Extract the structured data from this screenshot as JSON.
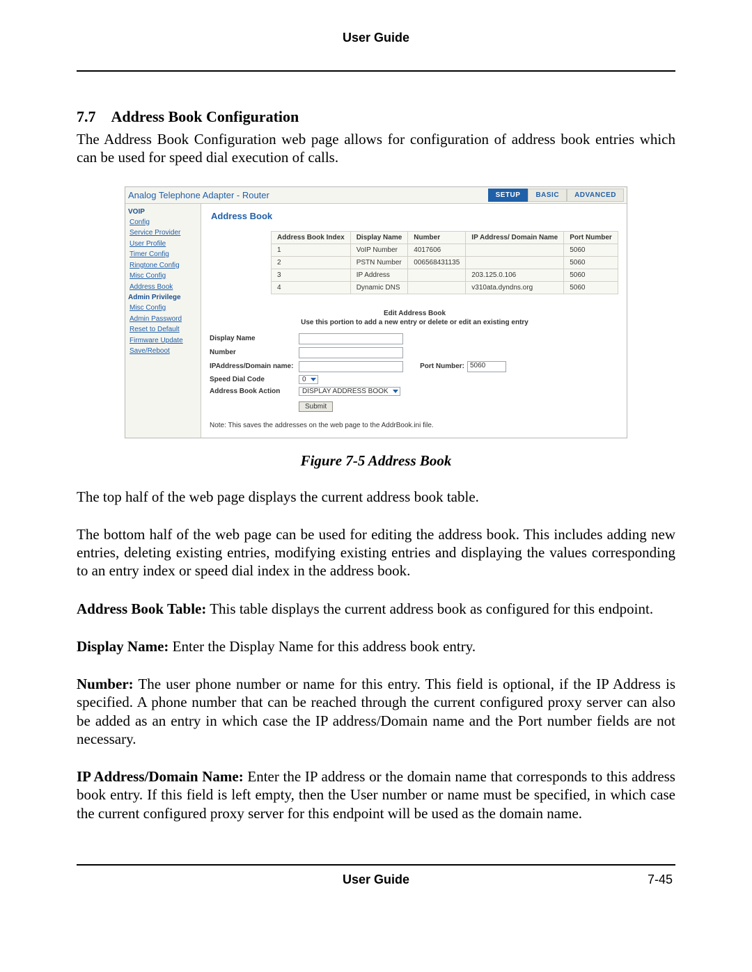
{
  "header": {
    "title": "User Guide"
  },
  "section": {
    "number": "7.7",
    "title": "Address Book Configuration",
    "intro": "The Address Book Configuration web page allows for configuration of address book entries which can be used for speed dial execution of calls."
  },
  "figure": {
    "app_title": "Analog Telephone Adapter - Router",
    "tabs": {
      "setup": "SETUP",
      "basic": "BASIC",
      "advanced": "ADVANCED"
    },
    "sidebar": {
      "group1": "VOIP",
      "items1": [
        "Config",
        "Service Provider",
        "User Profile",
        "Timer Config",
        "Ringtone Config",
        "Misc Config",
        "Address Book"
      ],
      "group2": "Admin Privilege",
      "items2": [
        "Misc Config",
        "Admin Password",
        "Reset to Default",
        "Firmware Update",
        "Save/Reboot"
      ]
    },
    "main": {
      "title": "Address Book",
      "columns": [
        "Address Book Index",
        "Display Name",
        "Number",
        "IP Address/ Domain Name",
        "Port Number"
      ],
      "rows": [
        {
          "index": "1",
          "display": "VoIP Number",
          "number": "4017606",
          "ip": "",
          "port": "5060"
        },
        {
          "index": "2",
          "display": "PSTN Number",
          "number": "006568431135",
          "ip": "",
          "port": "5060"
        },
        {
          "index": "3",
          "display": "IP Address",
          "number": "",
          "ip": "203.125.0.106",
          "port": "5060"
        },
        {
          "index": "4",
          "display": "Dynamic DNS",
          "number": "",
          "ip": "v310ata.dyndns.org",
          "port": "5060"
        }
      ],
      "edit_title": "Edit Address Book",
      "edit_sub": "Use this portion to add a new entry or delete or edit an existing entry",
      "labels": {
        "display_name": "Display Name",
        "number": "Number",
        "ip_domain": "IPAddress/Domain name:",
        "port_number": "Port Number:",
        "speed_dial": "Speed Dial Code",
        "action": "Address Book Action"
      },
      "values": {
        "port_number": "5060",
        "speed_dial": "0",
        "action": "DISPLAY ADDRESS BOOK"
      },
      "submit": "Submit",
      "note": "Note: This saves the addresses on the web page to the AddrBook.ini file."
    },
    "caption": "Figure 7-5 Address Book"
  },
  "paragraphs": {
    "p1": "The top half of the web page displays the current address book table.",
    "p2": "The bottom half of the web page can be used for editing the address book. This includes adding new entries, deleting existing entries, modifying existing entries and displaying the values corresponding to an entry index or speed dial index in the address book.",
    "p3_label": "Address Book Table:",
    "p3_text": " This table displays the current address book as configured for this endpoint.",
    "p4_label": "Display Name:",
    "p4_text": " Enter the Display Name for this address book entry.",
    "p5_label": "Number:",
    "p5_text": " The user phone number or name for this entry. This field is optional, if the IP Address is specified. A phone number that can be reached through the current configured proxy server can also be added as an entry in which case the IP address/Domain name and the Port number fields are not necessary.",
    "p6_label": "IP Address/Domain Name:",
    "p6_text": " Enter the IP address or the domain name that corresponds to this address book entry. If this field is left empty, then the User number or name must be specified, in which case the current configured proxy server for this endpoint will be used as the domain name."
  },
  "footer": {
    "title": "User Guide",
    "page": "7-45"
  }
}
